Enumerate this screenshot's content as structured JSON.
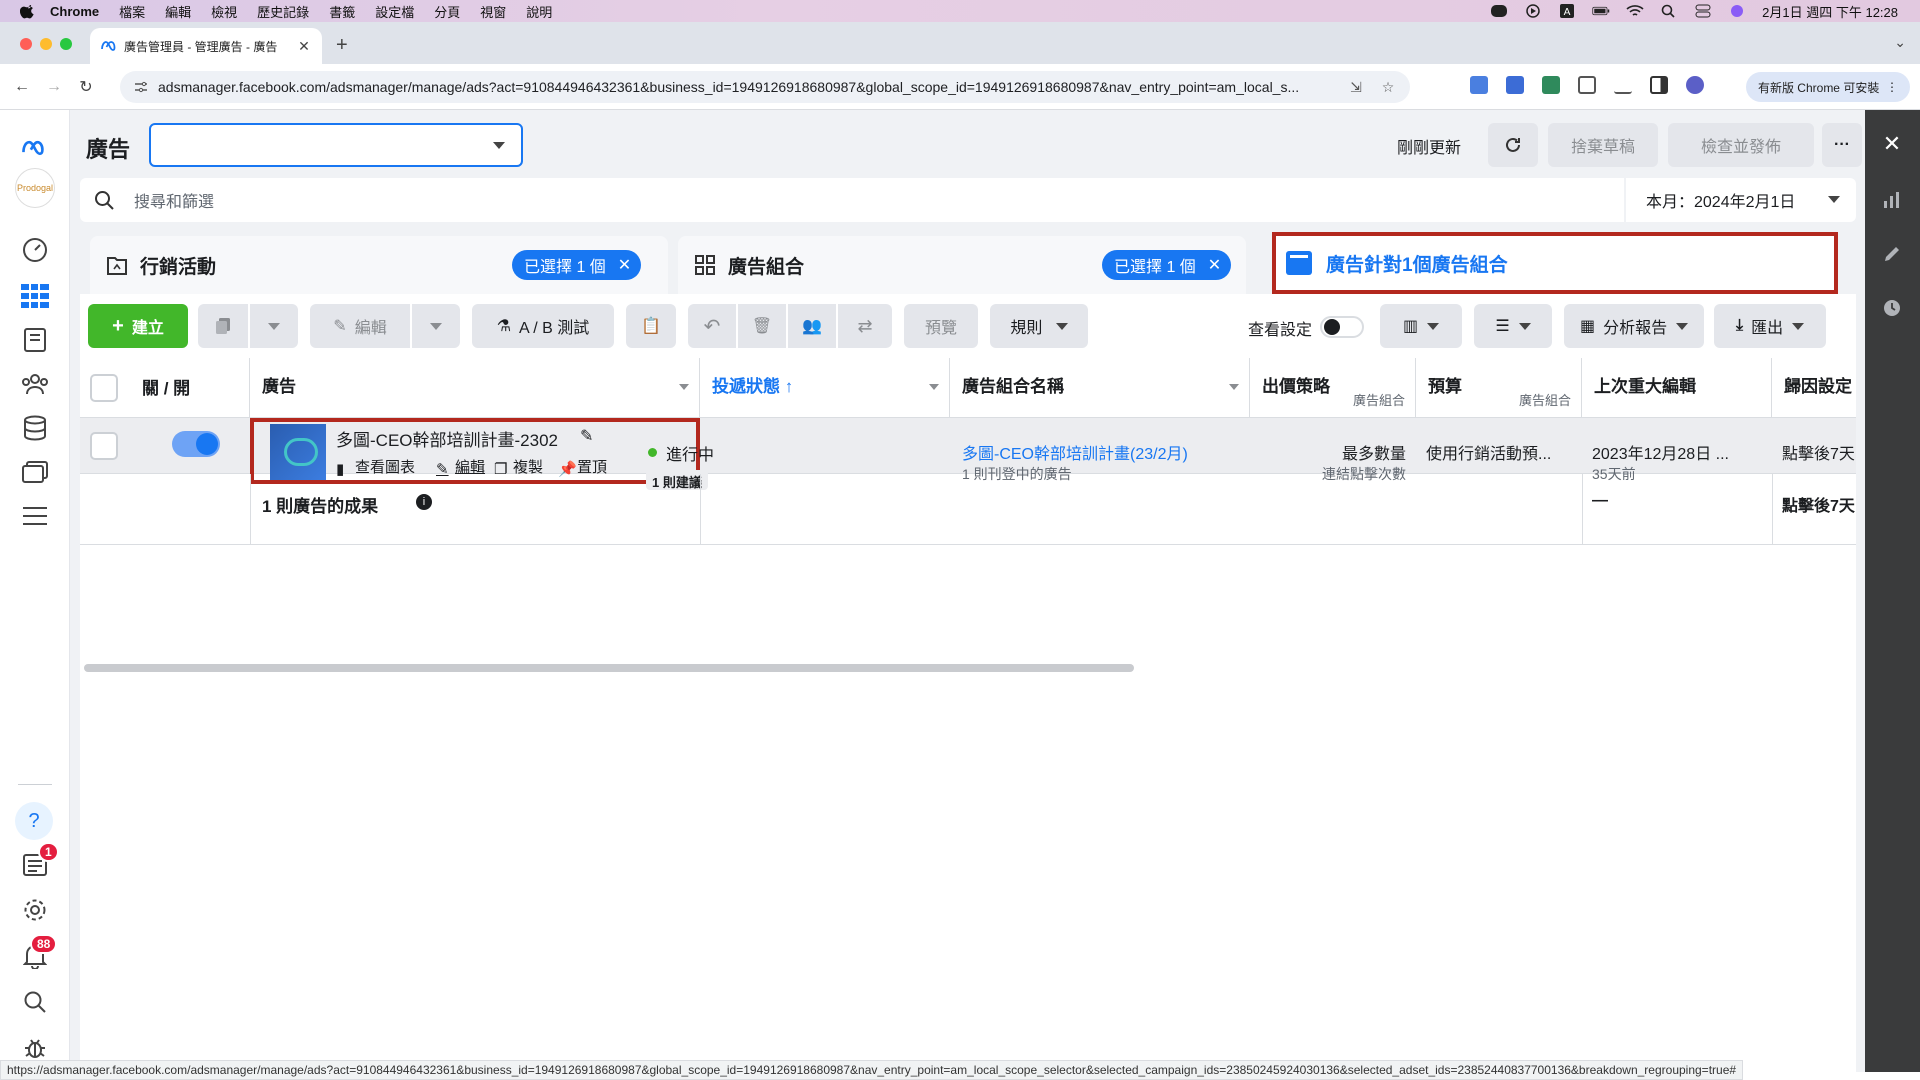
{
  "menubar": {
    "app": "Chrome",
    "items": [
      "檔案",
      "編輯",
      "檢視",
      "歷史記錄",
      "書籤",
      "設定檔",
      "分頁",
      "視窗",
      "說明"
    ],
    "datetime": "2月1日 週四 下午 12:28"
  },
  "browser": {
    "tab_title": "廣告管理員 - 管理廣告 - 廣告",
    "url": "adsmanager.facebook.com/adsmanager/manage/ads?act=910844946432361&business_id=1949126918680987&global_scope_id=1949126918680987&nav_entry_point=am_local_s...",
    "update_button": "有新版 Chrome 可安裝",
    "status_url": "https://adsmanager.facebook.com/adsmanager/manage/ads?act=910844946432361&business_id=1949126918680987&global_scope_id=1949126918680987&nav_entry_point=am_local_scope_selector&selected_campaign_ids=23850245924030136&selected_adset_ids=23852440837700136&breakdown_regrouping=true#"
  },
  "leftnav": {
    "notification_badge_1": "1",
    "notification_badge_2": "88"
  },
  "header": {
    "title": "廣告",
    "updated": "剛剛更新",
    "discard_draft": "捨棄草稿",
    "review_publish": "檢查並發佈",
    "more": "···"
  },
  "search": {
    "placeholder": "搜尋和篩選",
    "date_range": "本月：2024年2月1日"
  },
  "levels": {
    "campaigns": {
      "label": "行銷活動",
      "selected": "已選擇 1 個"
    },
    "adsets": {
      "label": "廣告組合",
      "selected": "已選擇 1 個"
    },
    "ads": {
      "label": "廣告針對1個廣告組合"
    }
  },
  "toolbar": {
    "create": "建立",
    "edit": "編輯",
    "ab_test": "A / B 測試",
    "preview": "預覽",
    "rules": "規則",
    "view_settings": "查看設定",
    "reports": "分析報告",
    "export": "匯出"
  },
  "table": {
    "headers": {
      "onoff": "關 / 開",
      "ad": "廣告",
      "delivery": "投遞狀態 ↑",
      "adset_name": "廣告組合名稱",
      "bid_strategy": "出價策略",
      "bid_strategy_sub": "廣告組合",
      "budget": "預算",
      "budget_sub": "廣告組合",
      "last_edit": "上次重大編輯",
      "attribution": "歸因設定"
    },
    "row": {
      "ad_name": "多圖-CEO幹部培訓計畫-2302",
      "action_chart": "查看圖表",
      "action_edit": "編輯",
      "action_duplicate": "複製",
      "action_pin": "置頂",
      "delivery": "進行中",
      "recommendation": "1 則建議",
      "adset_name": "多圖-CEO幹部培訓計畫(23/2月)",
      "adset_sub": "1 則刊登中的廣告",
      "bid_strategy": "最多數量",
      "bid_strategy_sub": "連結點擊次數",
      "budget": "使用行銷活動預...",
      "last_edit": "2023年12月28日 ...",
      "last_edit_sub": "35天前",
      "attribution": "點擊後7天"
    },
    "summary": {
      "label": "1 則廣告的成果",
      "last_edit": "—",
      "attribution": "點擊後7天"
    }
  },
  "colors": {
    "fb_blue": "#1877f2",
    "create_green": "#42b72a",
    "highlight_red": "#b3281e"
  }
}
